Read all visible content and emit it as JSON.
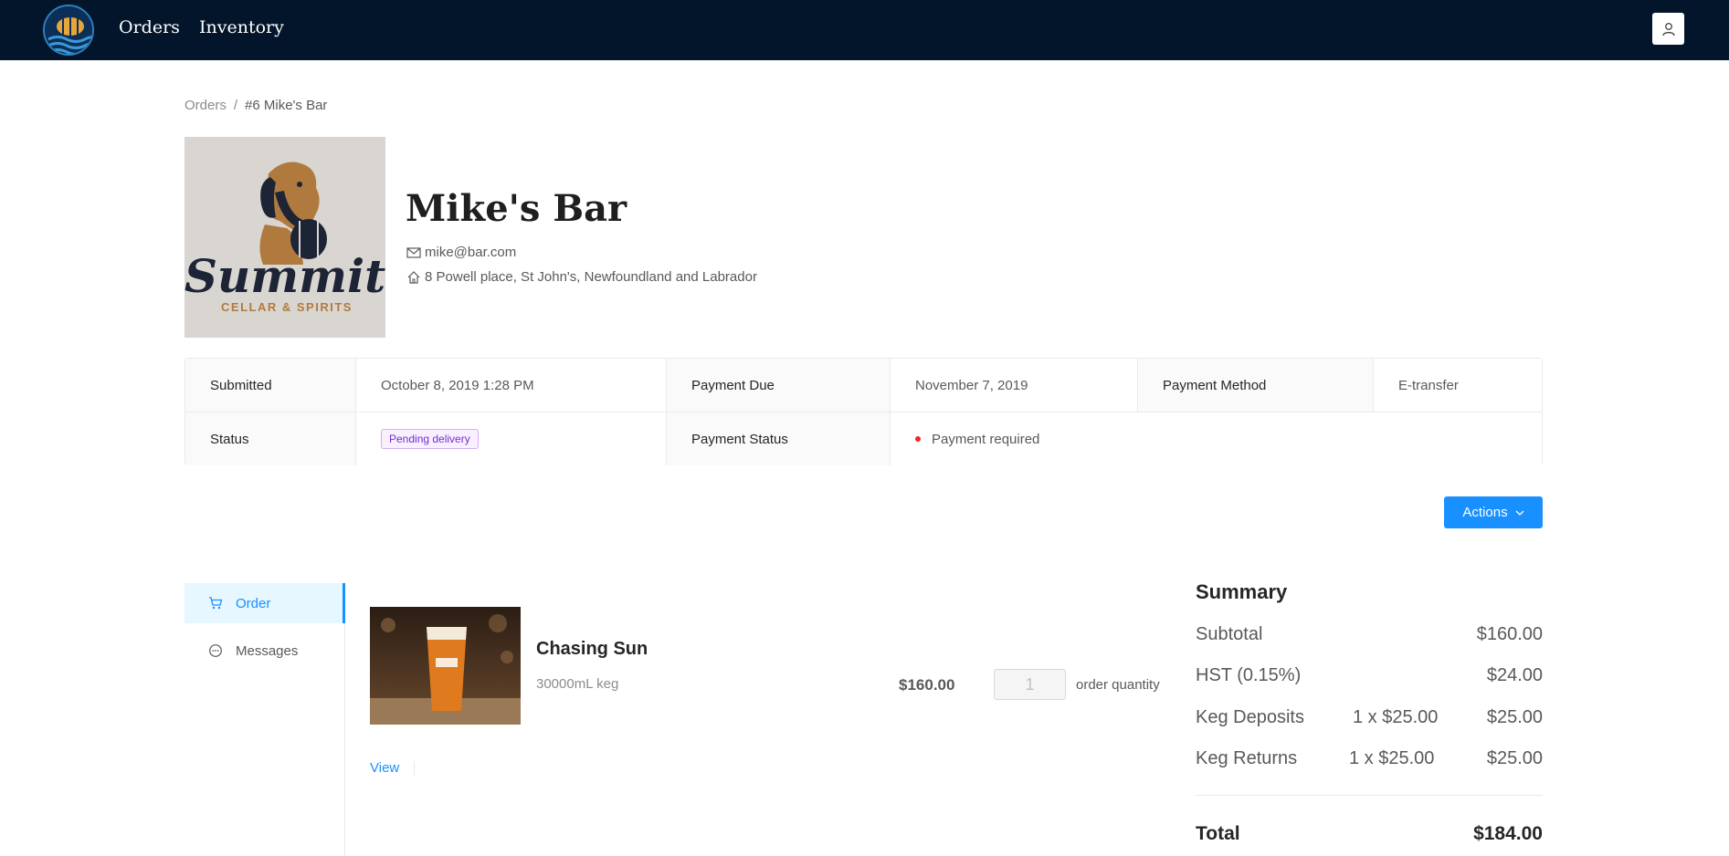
{
  "nav": {
    "links": [
      "Orders",
      "Inventory"
    ]
  },
  "breadcrumb": {
    "parent": "Orders",
    "separator": "/",
    "current": "#6 Mike's Bar"
  },
  "customer": {
    "name": "Mike's Bar",
    "email": "mike@bar.com",
    "address": "8 Powell place, St John's, Newfoundland and Labrador",
    "logo": {
      "word": "Summit",
      "subtitle": "CELLAR & SPIRITS"
    }
  },
  "order_info": {
    "submitted_label": "Submitted",
    "submitted_value": "October 8, 2019 1:28 PM",
    "payment_due_label": "Payment Due",
    "payment_due_value": "November 7, 2019",
    "payment_method_label": "Payment Method",
    "payment_method_value": "E-transfer",
    "status_label": "Status",
    "status_value": "Pending delivery",
    "payment_status_label": "Payment Status",
    "payment_status_value": "Payment required"
  },
  "actions": {
    "label": "Actions"
  },
  "side_menu": {
    "items": [
      {
        "label": "Order",
        "icon": "cart-icon"
      },
      {
        "label": "Messages",
        "icon": "message-icon"
      }
    ]
  },
  "product": {
    "name": "Chasing Sun",
    "size": "30000mL keg",
    "price": "$160.00",
    "quantity": "1",
    "quantity_label": "order quantity",
    "view_label": "View"
  },
  "summary": {
    "title": "Summary",
    "subtotal_label": "Subtotal",
    "subtotal_value": "$160.00",
    "hst_label": "HST (0.15%)",
    "hst_value": "$24.00",
    "deposits_label": "Keg Deposits",
    "deposits_detail": "1 x $25.00",
    "deposits_value": "$25.00",
    "returns_label": "Keg Returns",
    "returns_detail": "1 x $25.00",
    "returns_value": "$25.00",
    "total_label": "Total",
    "total_value": "$184.00"
  },
  "colors": {
    "navbar": "#03152a",
    "primary": "#1890ff",
    "status_tag": "#722ed1",
    "payment_dot": "#f5222d"
  }
}
